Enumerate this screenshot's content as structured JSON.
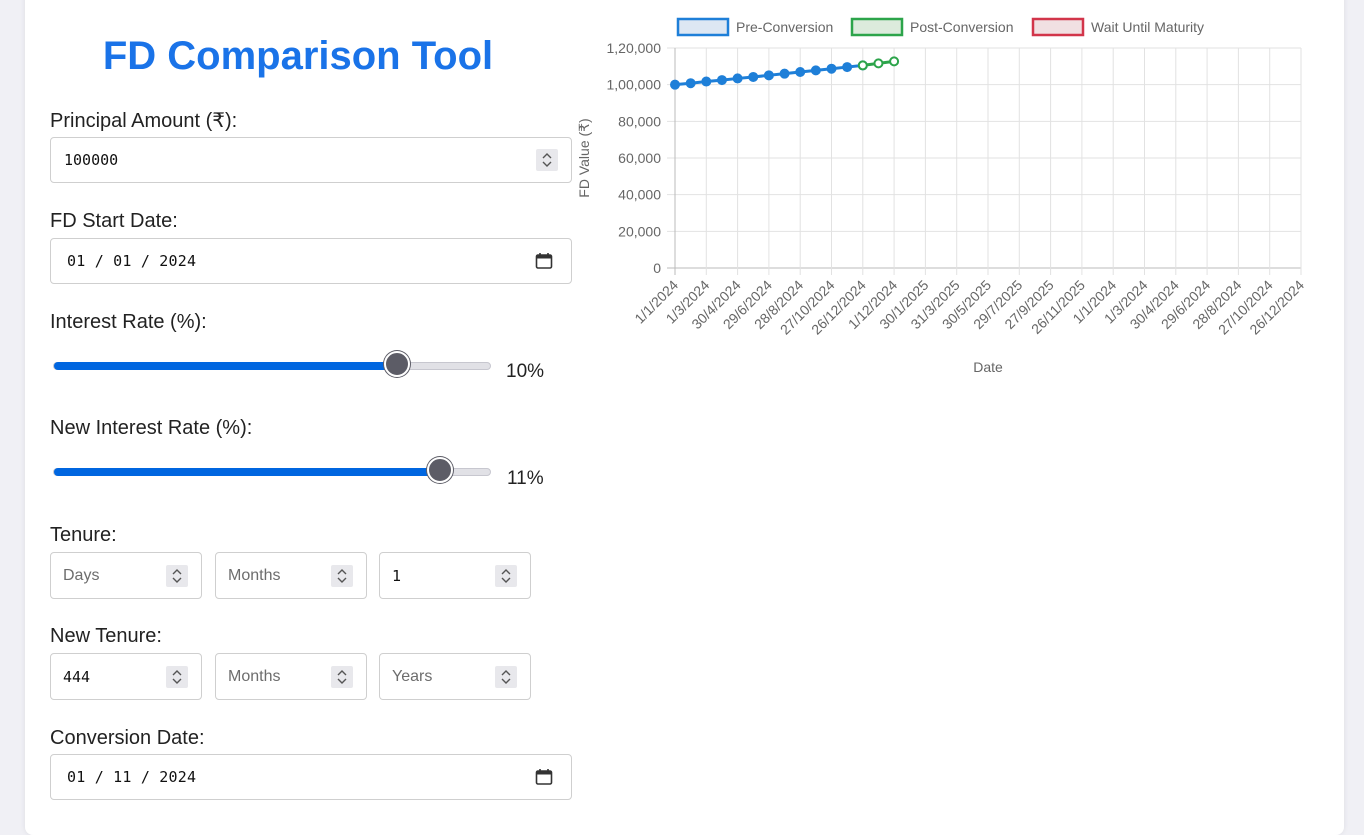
{
  "title": "FD Comparison Tool",
  "principal": {
    "label": "Principal Amount (₹):",
    "value": "100000"
  },
  "start_date": {
    "label": "FD Start Date:",
    "value": "01 / 01 / 2024"
  },
  "interest": {
    "label": "Interest Rate (%):",
    "display": "10%",
    "fraction": 0.78
  },
  "new_interest": {
    "label": "New Interest Rate (%):",
    "display": "11%",
    "fraction": 0.88
  },
  "tenure": {
    "label": "Tenure:",
    "days_placeholder": "Days",
    "months_placeholder": "Months",
    "years_value": "1"
  },
  "new_tenure": {
    "label": "New Tenure:",
    "days_value": "444",
    "months_placeholder": "Months",
    "years_placeholder": "Years"
  },
  "conversion_date": {
    "label": "Conversion Date:",
    "value": "01 / 11 / 2024"
  },
  "colors": {
    "accent": "#1a73e8",
    "pre": "#1e7fd8",
    "post": "#2ca44a",
    "wait": "#d2354a"
  },
  "chart_data": {
    "type": "line",
    "xlabel": "Date",
    "ylabel": "FD Value (₹)",
    "ylim": [
      0,
      120000
    ],
    "y_ticks": [
      "0",
      "20,000",
      "40,000",
      "60,000",
      "80,000",
      "1,00,000",
      "1,20,000"
    ],
    "x_tick_labels": [
      "1/1/2024",
      "1/3/2024",
      "30/4/2024",
      "29/6/2024",
      "28/8/2024",
      "27/10/2024",
      "26/12/2024",
      "1/12/2024",
      "30/1/2025",
      "31/3/2025",
      "30/5/2025",
      "29/7/2025",
      "27/9/2025",
      "26/11/2025",
      "1/1/2024",
      "1/3/2024",
      "30/4/2024",
      "29/6/2024",
      "28/8/2024",
      "27/10/2024",
      "26/12/2024"
    ],
    "legend": [
      "Pre-Conversion",
      "Post-Conversion",
      "Wait Until Maturity"
    ],
    "legend_position": "top",
    "grid": true,
    "series": [
      {
        "name": "Pre-Conversion",
        "x_index": [
          0,
          0.5,
          1,
          1.5,
          2,
          2.5,
          3,
          3.5,
          4,
          4.5,
          5,
          5.5,
          6
        ],
        "values": [
          100000,
          100800,
          101700,
          102500,
          103400,
          104200,
          105100,
          106000,
          106900,
          107800,
          108700,
          109600,
          110500
        ]
      },
      {
        "name": "Post-Conversion",
        "x_index": [
          6,
          6.5,
          7
        ],
        "values": [
          110500,
          111600,
          112700
        ]
      },
      {
        "name": "Wait Until Maturity",
        "x_index": [],
        "values": []
      }
    ]
  }
}
